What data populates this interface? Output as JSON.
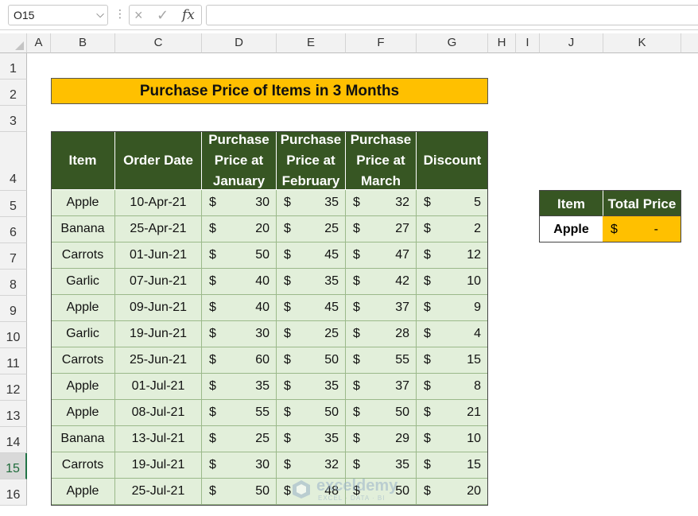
{
  "formula_bar": {
    "name_box": "O15",
    "cancel_icon": "×",
    "enter_icon": "✓",
    "fx_label": "fx",
    "formula": ""
  },
  "columns": [
    "A",
    "B",
    "C",
    "D",
    "E",
    "F",
    "G",
    "H",
    "I",
    "J",
    "K"
  ],
  "rows": [
    "1",
    "2",
    "3",
    "4",
    "5",
    "6",
    "7",
    "8",
    "9",
    "10",
    "11",
    "12",
    "13",
    "14",
    "15",
    "16"
  ],
  "title": "Purchase Price of Items in 3 Months",
  "table": {
    "headers": [
      "Item",
      "Order Date",
      "Purchase Price at January",
      "Purchase Price at February",
      "Purchase Price at March",
      "Discount"
    ],
    "currency": "$",
    "rows": [
      {
        "item": "Apple",
        "date": "10-Apr-21",
        "jan": "30",
        "feb": "35",
        "mar": "32",
        "disc": "5"
      },
      {
        "item": "Banana",
        "date": "25-Apr-21",
        "jan": "20",
        "feb": "25",
        "mar": "27",
        "disc": "2"
      },
      {
        "item": "Carrots",
        "date": "01-Jun-21",
        "jan": "50",
        "feb": "45",
        "mar": "47",
        "disc": "12"
      },
      {
        "item": "Garlic",
        "date": "07-Jun-21",
        "jan": "40",
        "feb": "35",
        "mar": "42",
        "disc": "10"
      },
      {
        "item": "Apple",
        "date": "09-Jun-21",
        "jan": "40",
        "feb": "45",
        "mar": "37",
        "disc": "9"
      },
      {
        "item": "Garlic",
        "date": "19-Jun-21",
        "jan": "30",
        "feb": "25",
        "mar": "28",
        "disc": "4"
      },
      {
        "item": "Carrots",
        "date": "25-Jun-21",
        "jan": "60",
        "feb": "50",
        "mar": "55",
        "disc": "15"
      },
      {
        "item": "Apple",
        "date": "01-Jul-21",
        "jan": "35",
        "feb": "35",
        "mar": "37",
        "disc": "8"
      },
      {
        "item": "Apple",
        "date": "08-Jul-21",
        "jan": "55",
        "feb": "50",
        "mar": "50",
        "disc": "21"
      },
      {
        "item": "Banana",
        "date": "13-Jul-21",
        "jan": "25",
        "feb": "35",
        "mar": "29",
        "disc": "10"
      },
      {
        "item": "Carrots",
        "date": "19-Jul-21",
        "jan": "30",
        "feb": "32",
        "mar": "35",
        "disc": "15"
      },
      {
        "item": "Apple",
        "date": "25-Jul-21",
        "jan": "50",
        "feb": "48",
        "mar": "50",
        "disc": "20"
      }
    ]
  },
  "lookup": {
    "headers": [
      "Item",
      "Total Price"
    ],
    "item": "Apple",
    "currency": "$",
    "total": "-"
  },
  "watermark": {
    "name": "exceldemy",
    "tagline": "EXCEL · DATA · BI"
  },
  "colors": {
    "header_green": "#375623",
    "row_green": "#e2efda",
    "title_gold": "#ffc000",
    "excel_green": "#217346"
  }
}
